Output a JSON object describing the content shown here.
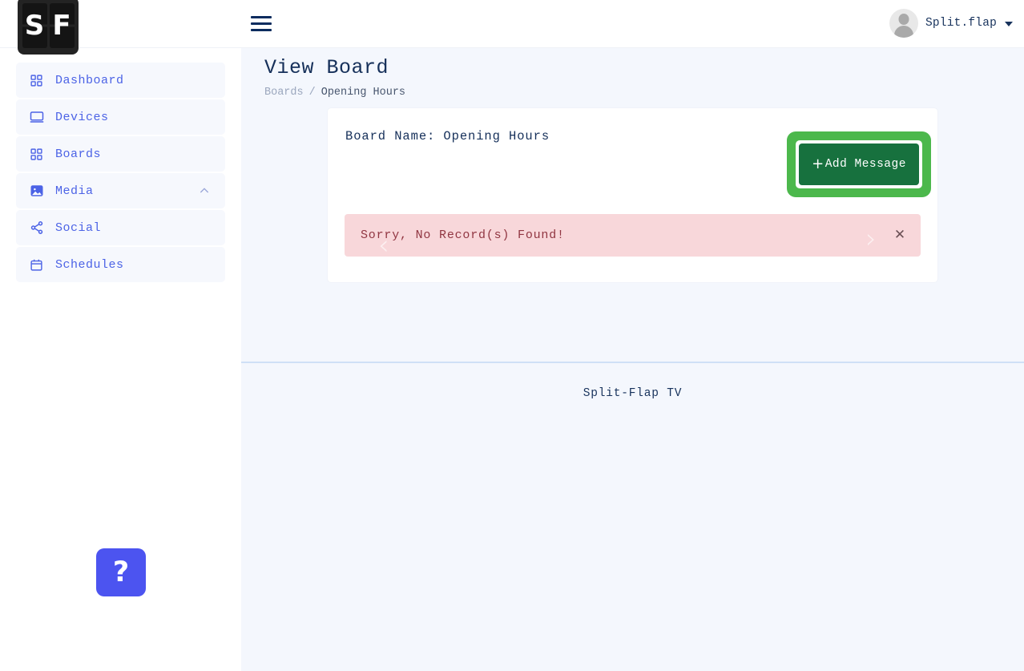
{
  "brand": {
    "logo_left_letter": "S",
    "logo_right_letter": "F",
    "accent_blue": "#4c63e6",
    "accent_navy": "#16305a",
    "highlight_green": "#4cb84c",
    "button_green": "#17713e",
    "alert_bg": "#f8d7da",
    "alert_text_color": "#913642",
    "help_blue": "#4c54f0"
  },
  "topbar": {
    "menu_icon": "hamburger-icon",
    "user_name": "Split.flap",
    "user_caret_icon": "chevron-down-icon",
    "avatar_icon": "user-avatar-icon"
  },
  "sidebar": {
    "items": [
      {
        "label": "Dashboard",
        "icon": "grid-icon",
        "expandable": false
      },
      {
        "label": "Devices",
        "icon": "monitor-icon",
        "expandable": false
      },
      {
        "label": "Boards",
        "icon": "grid-icon",
        "expandable": false
      },
      {
        "label": "Media",
        "icon": "image-icon",
        "expandable": true,
        "chevron": "chevron-up-icon"
      },
      {
        "label": "Social",
        "icon": "share-icon",
        "expandable": false
      },
      {
        "label": "Schedules",
        "icon": "calendar-icon",
        "expandable": false
      }
    ],
    "help_button_label": "?"
  },
  "page": {
    "title": "View Board",
    "breadcrumb": {
      "parent": "Boards",
      "separator": "/",
      "current": "Opening Hours"
    }
  },
  "card": {
    "board_name_label": "Board Name: Opening Hours",
    "add_button": {
      "plus": "+",
      "label": "Add Message",
      "highlighted": true
    },
    "alert": {
      "message": "Sorry, No Record(s) Found!",
      "close_icon": "close-icon",
      "prev_icon": "chevron-left-icon",
      "next_icon": "chevron-right-icon",
      "prev_glyph": "‹",
      "next_glyph": "›",
      "close_glyph": "✕"
    }
  },
  "footer": {
    "text": "Split-Flap TV"
  }
}
